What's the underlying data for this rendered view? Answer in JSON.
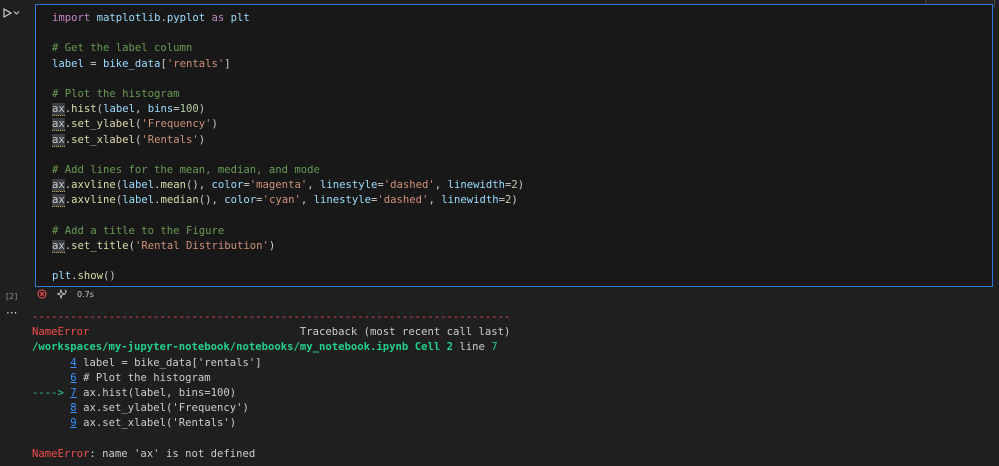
{
  "cell": {
    "execution_count": "[2]",
    "duration": "0.7s",
    "code_lines": [
      "import matplotlib.pyplot as plt",
      "",
      "# Get the label column",
      "label = bike_data['rentals']",
      "",
      "# Plot the histogram",
      "ax.hist(label, bins=100)",
      "ax.set_ylabel('Frequency')",
      "ax.set_xlabel('Rentals')",
      "",
      "# Add lines for the mean, median, and mode",
      "ax.axvline(label.mean(), color='magenta', linestyle='dashed', linewidth=2)",
      "ax.axvline(label.median(), color='cyan', linestyle='dashed', linewidth=2)",
      "",
      "# Add a title to the Figure",
      "ax.set_title('Rental Distribution')",
      "",
      "plt.show()"
    ]
  },
  "output": {
    "separator": "---------------------------------------------------------------------------",
    "error_name": "NameError",
    "traceback_header": "Traceback (most recent call last)",
    "file_path": "/workspaces/my-jupyter-notebook/notebooks/my_notebook.ipynb",
    "cell_ref": "Cell 2",
    "line_ref": "line 7",
    "trace_lines": [
      {
        "arrow": "      ",
        "num": "4",
        "code": "label = bike_data['rentals']"
      },
      {
        "arrow": "      ",
        "num": "6",
        "code": "# Plot the histogram"
      },
      {
        "arrow": "----> ",
        "num": "7",
        "code": "ax.hist(label, bins=100)"
      },
      {
        "arrow": "      ",
        "num": "8",
        "code": "ax.set_ylabel('Frequency')"
      },
      {
        "arrow": "      ",
        "num": "9",
        "code": "ax.set_xlabel('Rentals')"
      }
    ],
    "final_error_name": "NameError",
    "final_error_msg": ": name 'ax' is not defined"
  },
  "icons": {
    "run": "run-cell-icon",
    "error": "error-circle-icon",
    "sparkle": "sparkle-icon",
    "more": "more-actions-icon"
  }
}
